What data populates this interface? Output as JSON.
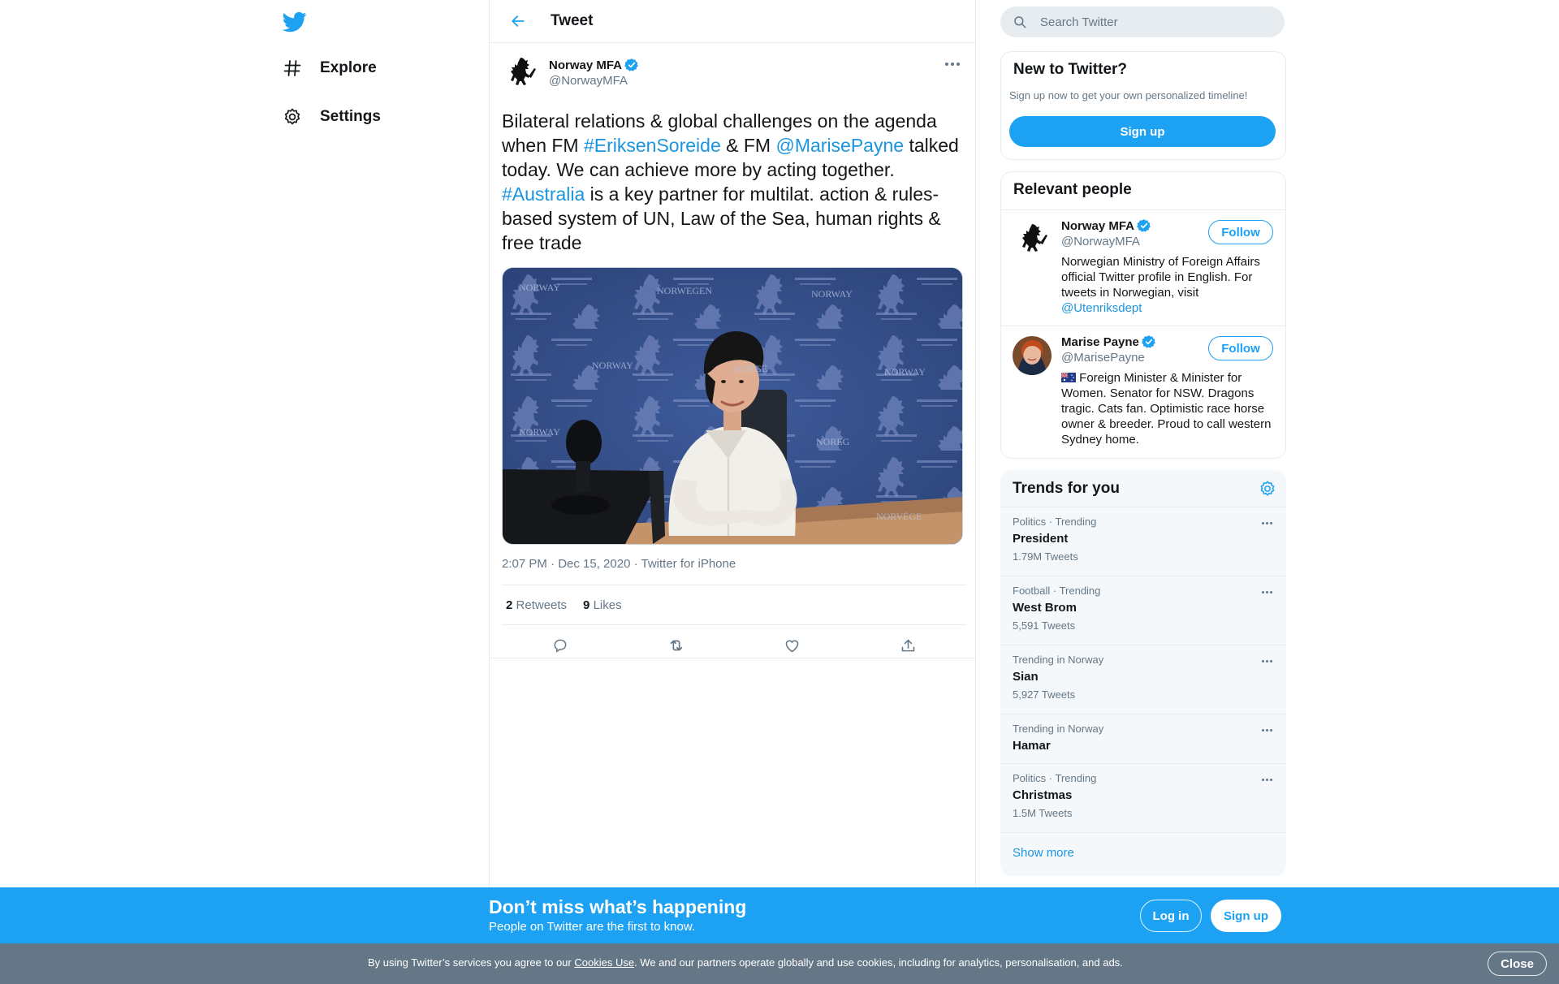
{
  "colors": {
    "accent": "#1da1f2",
    "link": "#1b95e0",
    "muted": "#657786",
    "cookie_bg": "#657786"
  },
  "nav": {
    "explore_label": "Explore",
    "settings_label": "Settings"
  },
  "header": {
    "title": "Tweet"
  },
  "tweet": {
    "author_name": "Norway MFA",
    "author_handle": "@NorwayMFA",
    "text_parts": {
      "p1": "Bilateral relations & global challenges on the agenda when FM ",
      "hashtag1": "#EriksenSoreide",
      "p2": " & FM  ",
      "mention1": "@MarisePayne",
      "p3": " talked today. We can achieve more by acting together. ",
      "hashtag2": "#Australia",
      "p4": " is a key partner for multilat. action & rules-based system of UN, Law of the Sea, human rights & free trade"
    },
    "time": "2:07 PM · Dec 15, 2020 · ",
    "source": "Twitter for iPhone",
    "retweets_count": "2",
    "retweets_label": "Retweets",
    "likes_count": "9",
    "likes_label": "Likes"
  },
  "search": {
    "placeholder": "Search Twitter"
  },
  "new_to_twitter": {
    "title": "New to Twitter?",
    "subtitle": "Sign up now to get your own personalized timeline!",
    "button": "Sign up"
  },
  "relevant": {
    "title": "Relevant people",
    "follow_label": "Follow",
    "people": [
      {
        "name": "Norway MFA",
        "handle": "@NorwayMFA",
        "bio": "Norwegian Ministry of Foreign Affairs official Twitter profile in English. For tweets in Norwegian, visit ",
        "bio_link": "@Utenriksdept"
      },
      {
        "name": "Marise Payne",
        "handle": "@MarisePayne",
        "bio": " Foreign Minister & Minister for Women. Senator for NSW. Dragons tragic. Cats fan. Optimistic race horse owner & breeder. Proud to call western Sydney home."
      }
    ]
  },
  "trends": {
    "title": "Trends for you",
    "items": [
      {
        "context": "Politics · Trending",
        "name": "President",
        "count": "1.79M Tweets"
      },
      {
        "context": "Football · Trending",
        "name": "West Brom",
        "count": "5,591 Tweets"
      },
      {
        "context": "Trending in Norway",
        "name": "Sian",
        "count": "5,927 Tweets"
      },
      {
        "context": "Trending in Norway",
        "name": "Hamar",
        "count": ""
      },
      {
        "context": "Politics · Trending",
        "name": "Christmas",
        "count": "1.5M Tweets"
      }
    ],
    "show_more": "Show more"
  },
  "banner": {
    "title": "Don’t miss what’s happening",
    "subtitle": "People on Twitter are the first to know.",
    "login": "Log in",
    "signup": "Sign up"
  },
  "cookie": {
    "text_before": "By using Twitter’s services you agree to our ",
    "link": "Cookies Use",
    "text_after": ". We and our partners operate globally and use cookies, including for analytics, personalisation, and ads.",
    "close": "Close"
  }
}
